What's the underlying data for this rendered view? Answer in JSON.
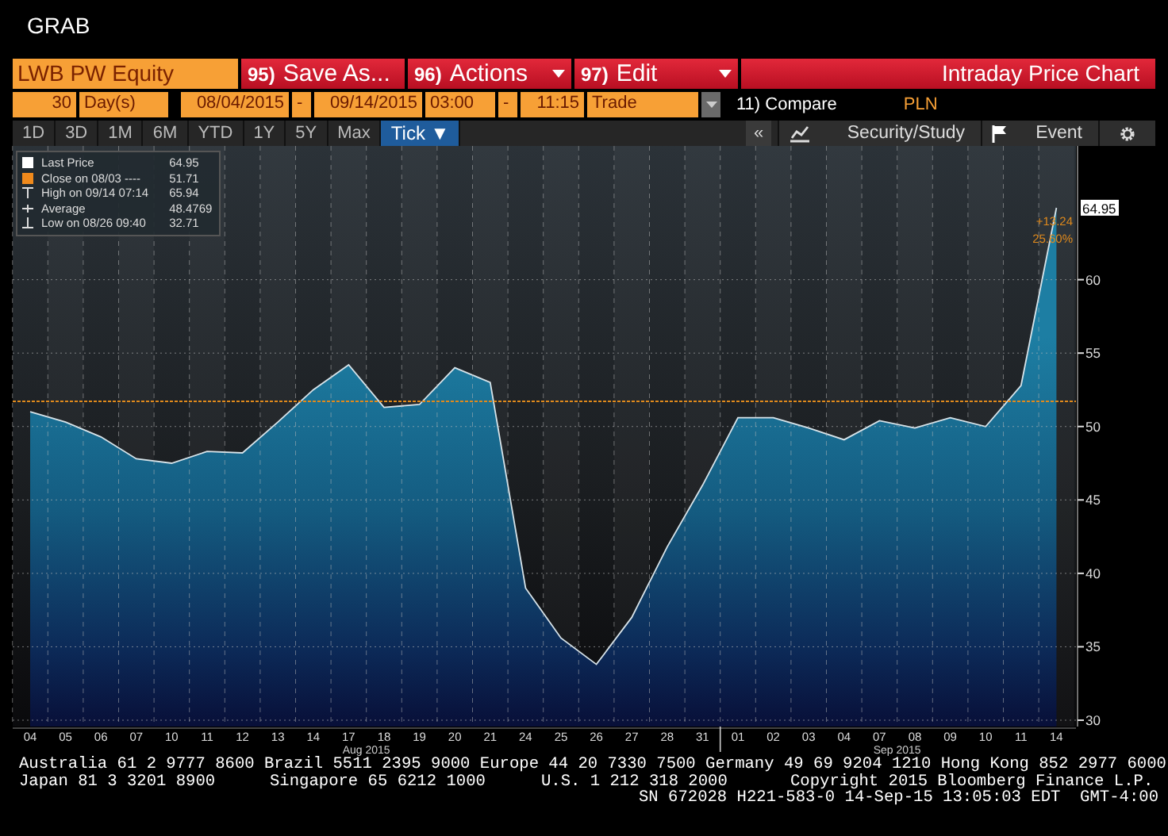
{
  "title": "GRAB",
  "toolbar": {
    "security": "LWB PW Equity",
    "buttons": [
      {
        "number": "95)",
        "label": "Save As...",
        "menu": false
      },
      {
        "number": "96)",
        "label": "Actions",
        "menu": true
      },
      {
        "number": "97)",
        "label": "Edit",
        "menu": true
      }
    ],
    "chart_name": "Intraday Price Chart"
  },
  "range_bar": {
    "period": "30",
    "period_unit": "Day(s)",
    "start_date": "08/04/2015",
    "date_separator": "-",
    "end_date": "09/14/2015",
    "start_time": "03:00",
    "time_separator": "-",
    "end_time": "11:15",
    "field": "Trade",
    "compare": "11) Compare",
    "currency": "PLN"
  },
  "periods": [
    {
      "label": "1D",
      "selected": false
    },
    {
      "label": "3D",
      "selected": false
    },
    {
      "label": "1M",
      "selected": false
    },
    {
      "label": "6M",
      "selected": false
    },
    {
      "label": "YTD",
      "selected": false
    },
    {
      "label": "1Y",
      "selected": false
    },
    {
      "label": "5Y",
      "selected": false
    },
    {
      "label": "Max",
      "selected": false
    },
    {
      "label": "Tick ▼",
      "selected": true
    }
  ],
  "side_tools": {
    "collapse": "«",
    "items": [
      {
        "label": "Security/Study",
        "kind": "study"
      },
      {
        "label": "Event",
        "kind": "event"
      }
    ]
  },
  "legend": [
    {
      "kind": "last",
      "label": "Last Price",
      "value": "64.95"
    },
    {
      "kind": "close",
      "label": "Close on 08/03 ----",
      "value": "51.71"
    },
    {
      "kind": "high",
      "label": "High on 09/14 07:14",
      "value": "65.94"
    },
    {
      "kind": "average",
      "label": "Average",
      "value": "48.4769"
    },
    {
      "kind": "low",
      "label": "Low on 08/26 09:40",
      "value": "32.71"
    }
  ],
  "chart": {
    "last_tag": "64.95",
    "change": "+13.24",
    "change_pct": "25.60%",
    "months": [
      {
        "label": "Aug 2015"
      },
      {
        "label": "Sep 2015"
      }
    ],
    "chart_data": {
      "type": "area",
      "categories": [
        "04",
        "05",
        "06",
        "07",
        "10",
        "11",
        "12",
        "13",
        "14",
        "17",
        "18",
        "19",
        "20",
        "21",
        "24",
        "25",
        "26",
        "27",
        "28",
        "31",
        "01",
        "02",
        "03",
        "04",
        "07",
        "08",
        "09",
        "10",
        "11",
        "14"
      ],
      "series": [
        {
          "color": "#d8e4ea",
          "values": [
            51,
            50.3,
            49.3,
            47.8,
            47.5,
            48.3,
            48.2,
            50.3,
            52.5,
            54.2,
            51.3,
            51.5,
            54,
            53,
            39,
            35.6,
            33.8,
            37,
            41.8,
            46,
            50.6,
            50.6,
            49.9,
            49.1,
            50.4,
            49.9,
            50.6,
            50,
            52.8,
            64.9
          ]
        }
      ],
      "ylim": [
        30,
        69
      ],
      "yticks": [
        30,
        35,
        40,
        45,
        50,
        55,
        60
      ],
      "grid": true,
      "ref_lines": [
        {
          "axis": "y",
          "value": 51.71,
          "color": "#e08a1c"
        }
      ]
    }
  },
  "footer": [
    [
      "Australia 61 2 9777 8600 Brazil 5511 2395 9000 Europe 44 20 7330 7500 Germany 49 69 9204 1210 Hong Kong 852 2977 6000"
    ],
    [
      "Japan 81 3 3201 8900",
      "Singapore 65 6212 1000",
      "U.S. 1 212 318 2000",
      "Copyright 2015 Bloomberg Finance L.P."
    ],
    [
      "SN 672028 H221-583-0 14-Sep-15 13:05:03 EDT  GMT-4:00"
    ]
  ]
}
